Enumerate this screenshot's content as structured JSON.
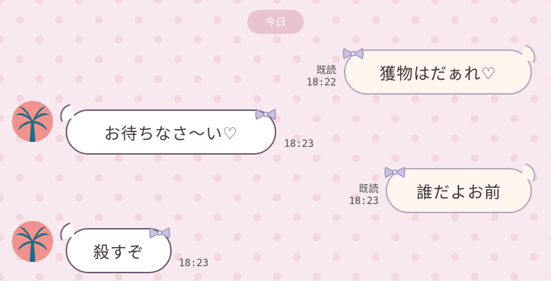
{
  "date_label": "今日",
  "messages": [
    {
      "side": "out",
      "text": "獲物はだぁれ♡",
      "read": "既読",
      "time": "18:22"
    },
    {
      "side": "in",
      "text": "お待ちなさ〜い♡",
      "time": "18:23"
    },
    {
      "side": "out",
      "text": "誰だよお前",
      "read": "既読",
      "time": "18:23"
    },
    {
      "side": "in",
      "text": "殺すぞ",
      "time": "18:23"
    }
  ],
  "avatar_icon": "palm-tree-icon",
  "bow_icon": "ribbon-bow-icon",
  "colors": {
    "background": "#f7e9ef",
    "avatar_bg": "#f0928d",
    "palm": "#1e6b84",
    "incoming_border": "#6a5870",
    "outgoing_border": "#b8a4b8",
    "outgoing_fill": "#fff7ef",
    "bow": "#c9c2e3"
  }
}
